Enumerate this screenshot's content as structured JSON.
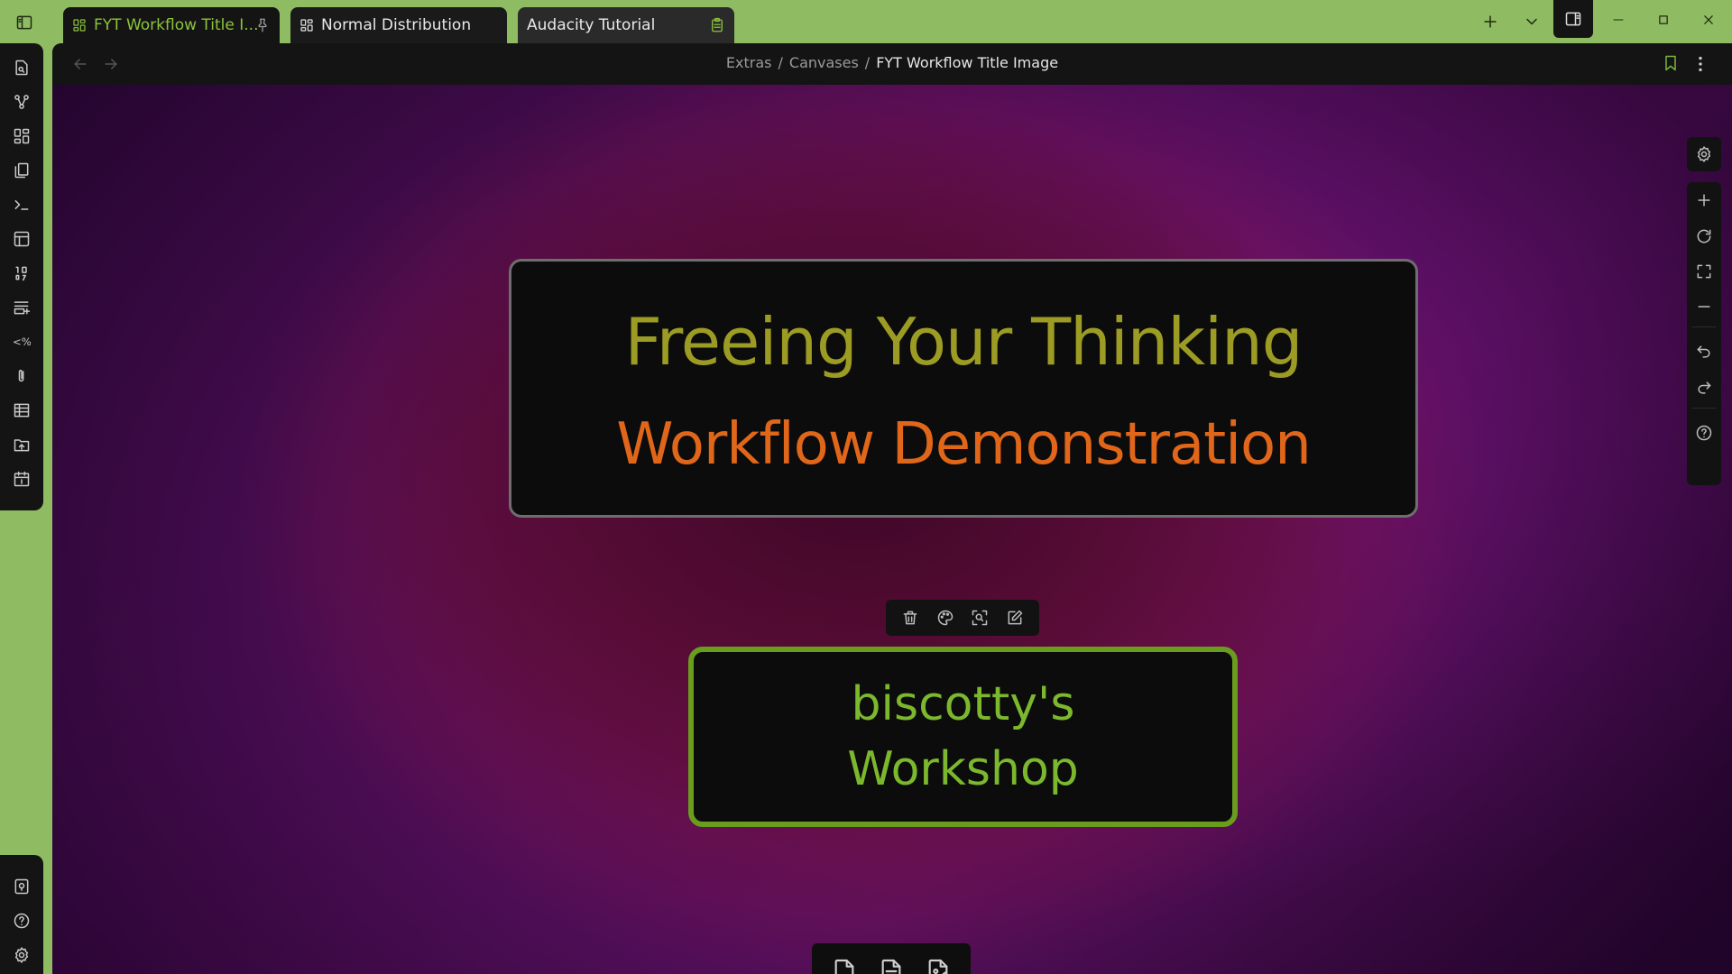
{
  "tabs": [
    {
      "label": "FYT Workflow Title I...",
      "active": true,
      "pinned": true,
      "icon": "canvas-icon"
    },
    {
      "label": "Normal Distribution",
      "active": false,
      "icon": "canvas-icon"
    },
    {
      "label": "Audacity Tutorial",
      "active": false,
      "icon": "clipboard-icon"
    }
  ],
  "breadcrumb": {
    "parts": [
      "Extras",
      "Canvases"
    ],
    "separator": "/",
    "current": "FYT Workflow Title Image"
  },
  "canvas": {
    "title_card": {
      "line1": "Freeing Your Thinking",
      "line2": "Workflow Demonstration"
    },
    "workshop_card": {
      "text": "biscotty's Workshop"
    }
  },
  "ribbon": {
    "top_icons": [
      "search-file-icon",
      "graph-icon",
      "dashboard-icon",
      "files-icon",
      "terminal-icon",
      "layout-icon",
      "sort-numbers-icon",
      "new-note-icon",
      "templater-icon",
      "paperclip-icon",
      "table-icon",
      "upload-folder-icon",
      "calendar-icon"
    ],
    "bottom_icons": [
      "vault-icon",
      "help-icon",
      "settings-icon"
    ]
  },
  "colors": {
    "accent": "#8fbb62",
    "title_line1": "#9c9c24",
    "title_line2": "#e0661a",
    "workshop_border": "#6a9c1e",
    "workshop_text": "#7cb82e"
  }
}
